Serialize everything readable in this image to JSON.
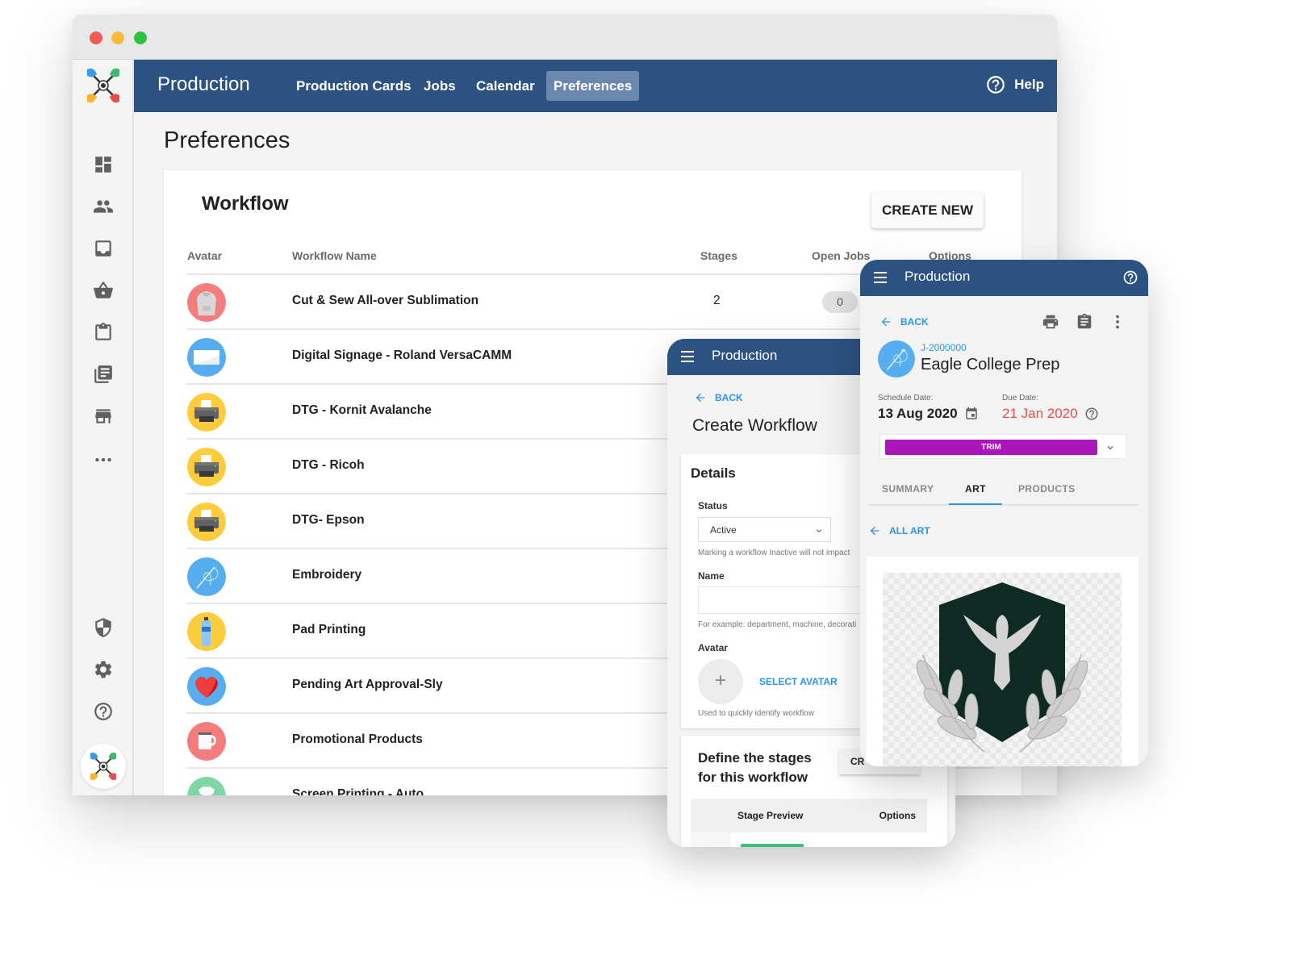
{
  "window": {
    "app_title": "Production",
    "nav": [
      {
        "label": "Production Cards",
        "active": false
      },
      {
        "label": "Jobs",
        "active": false
      },
      {
        "label": "Calendar",
        "active": false
      },
      {
        "label": "Preferences",
        "active": true
      }
    ],
    "help_label": "Help",
    "sidebar_icons": [
      "dashboard-icon",
      "people-icon",
      "inbox-icon",
      "basket-icon",
      "clipboard-icon",
      "library-icon",
      "store-icon",
      "more-icon",
      "shield-icon",
      "gear-icon",
      "help-icon"
    ],
    "page_title": "Preferences"
  },
  "workflow": {
    "title": "Workflow",
    "create_button": "CREATE NEW",
    "columns": {
      "avatar": "Avatar",
      "name": "Workflow Name",
      "stages": "Stages",
      "open_jobs": "Open Jobs",
      "options": "Options"
    },
    "rows": [
      {
        "name": "Cut & Sew All-over Sublimation",
        "avatar": "hoodie",
        "color": "#f47c7c",
        "stages": "2",
        "open_jobs": "0"
      },
      {
        "name": "Digital Signage - Roland VersaCAMM",
        "avatar": "banner",
        "color": "#56aef1"
      },
      {
        "name": "DTG - Kornit Avalanche",
        "avatar": "printer",
        "color": "#fdcc3c"
      },
      {
        "name": "DTG - Ricoh",
        "avatar": "printer",
        "color": "#fdcc3c"
      },
      {
        "name": "DTG- Epson",
        "avatar": "printer",
        "color": "#fdcc3c"
      },
      {
        "name": "Embroidery",
        "avatar": "needle",
        "color": "#56aef1"
      },
      {
        "name": "Pad Printing",
        "avatar": "bottle",
        "color": "#fdcc3c"
      },
      {
        "name": "Pending Art Approval-Sly",
        "avatar": "heart",
        "color": "#56aef1"
      },
      {
        "name": "Promotional Products",
        "avatar": "mug",
        "color": "#f47c7c"
      },
      {
        "name": "Screen Printing - Auto",
        "avatar": "shirt",
        "color": "#7fd6a5"
      }
    ]
  },
  "create_workflow_panel": {
    "app_title": "Production",
    "back_label": "BACK",
    "title": "Create Workflow",
    "details_title": "Details",
    "status_label": "Status",
    "status_value": "Active",
    "status_hint": "Marking a workflow Inactive will not impact",
    "name_label": "Name",
    "name_value": "",
    "name_hint": "For example: department, machine, decorati",
    "avatar_label": "Avatar",
    "select_avatar": "SELECT AVATAR",
    "avatar_hint": "Used to quickly identify workflow",
    "stages_title": "Define the stages for this workflow",
    "stages_button": "CR",
    "stage_columns": {
      "preview": "Stage Preview",
      "options": "Options"
    }
  },
  "job_panel": {
    "app_title": "Production",
    "back_label": "BACK",
    "job_id": "J-2000000",
    "job_name": "Eagle College Prep",
    "schedule_label": "Schedule Date:",
    "schedule_value": "13 Aug 2020",
    "due_label": "Due Date:",
    "due_value": "21 Jan 2020",
    "status": "TRIM",
    "status_color": "#ab16bb",
    "tabs": [
      {
        "label": "SUMMARY",
        "active": false
      },
      {
        "label": "ART",
        "active": true
      },
      {
        "label": "PRODUCTS",
        "active": false
      }
    ],
    "all_art_label": "ALL ART"
  }
}
